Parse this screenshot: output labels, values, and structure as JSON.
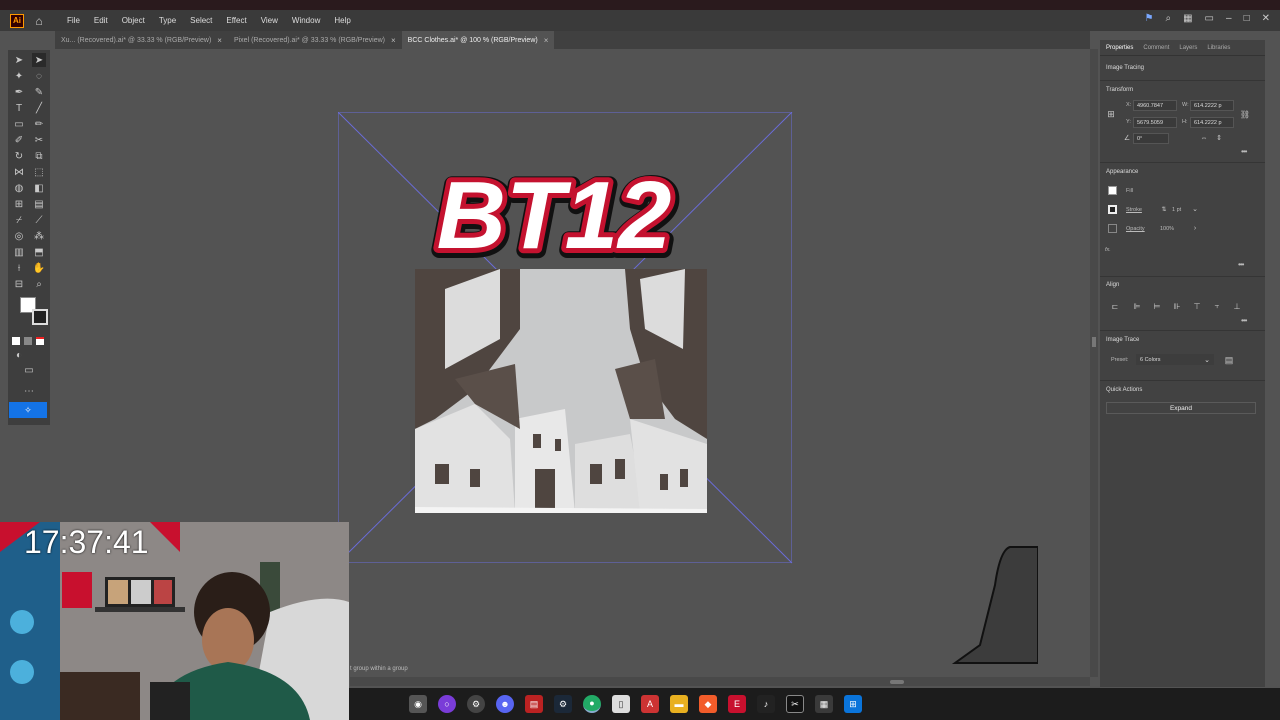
{
  "app": {
    "logo_text": "Ai",
    "menu": [
      "File",
      "Edit",
      "Object",
      "Type",
      "Select",
      "Effect",
      "View",
      "Window",
      "Help"
    ]
  },
  "tabs": [
    {
      "label": "Xu... (Recovered).ai* @ 33.33 % (RGB/Preview)",
      "active": false
    },
    {
      "label": "Pixel (Recovered).ai* @ 33.33 % (RGB/Preview)",
      "active": false
    },
    {
      "label": "BCC Clothes.ai* @ 100 % (RGB/Preview)",
      "active": true
    }
  ],
  "canvas": {
    "artwork_title": "BT12",
    "status_text": "t group within a group"
  },
  "panel": {
    "tabs": [
      "Properties",
      "Comment",
      "Layers",
      "Libraries"
    ],
    "active_tab": "Properties",
    "image_tracing": "Image Tracing",
    "transform": {
      "title": "Transform",
      "x_label": "X:",
      "x": "4960.7847",
      "y_label": "Y:",
      "y": "5679.5059",
      "w_label": "W:",
      "w": "614.2222 p",
      "h_label": "H:",
      "h": "614.2222 p",
      "angle": "0°"
    },
    "appearance": {
      "title": "Appearance",
      "fill_label": "Fill",
      "stroke_label": "Stroke",
      "stroke_value": "1 pt",
      "opacity_label": "Opacity",
      "opacity_value": "100%",
      "fx": "fx."
    },
    "align": {
      "title": "Align"
    },
    "image_trace": {
      "title": "Image Trace",
      "preset_label": "Preset:",
      "preset_value": "6 Colors"
    },
    "quick_actions": {
      "title": "Quick Actions",
      "expand_label": "Expand"
    }
  },
  "overlay": {
    "timer": "17:37:41"
  },
  "colors": {
    "accent": "#1473e6",
    "selection": "#6a6cd8",
    "title_red": "#c4122f"
  }
}
